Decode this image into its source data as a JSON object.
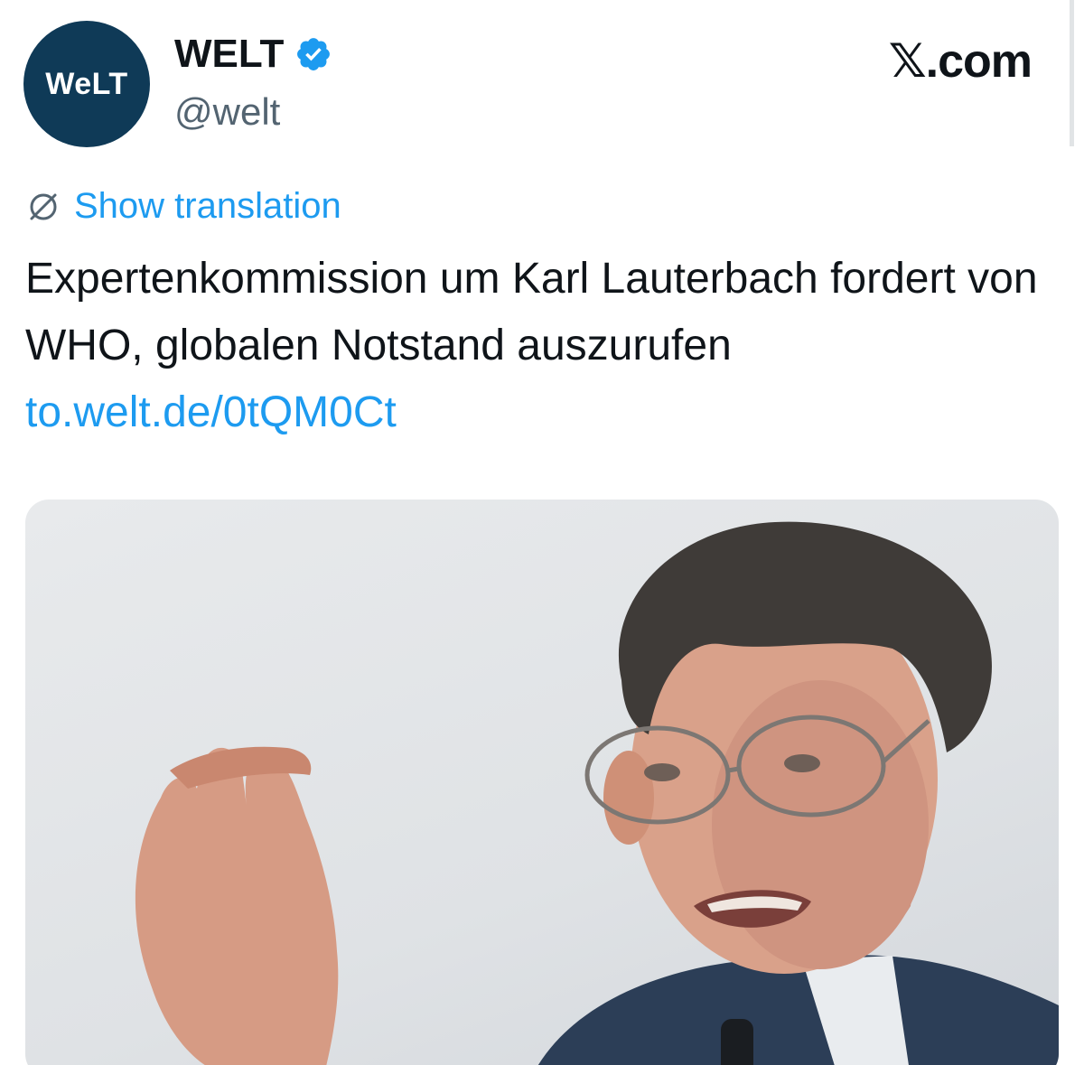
{
  "author": {
    "avatar_text": "WeLT",
    "display_name": "WELT",
    "verified": true,
    "handle": "@welt"
  },
  "source_label": "𝕏.com",
  "translate": {
    "label": "Show translation",
    "icon": "globe-icon"
  },
  "tweet": {
    "text": "Expertenkommission um Karl Lauterbach fordert von WHO, globalen Notstand auszurufen ",
    "link": "to.welt.de/0tQM0Ct"
  },
  "media": {
    "description": "photo of a man with glasses speaking and gesturing with his hand"
  },
  "colors": {
    "brand_blue": "#0f3a57",
    "link_blue": "#1d9bf0",
    "verified_blue": "#1d9bf0",
    "text": "#0f1419",
    "secondary_text": "#536471"
  }
}
